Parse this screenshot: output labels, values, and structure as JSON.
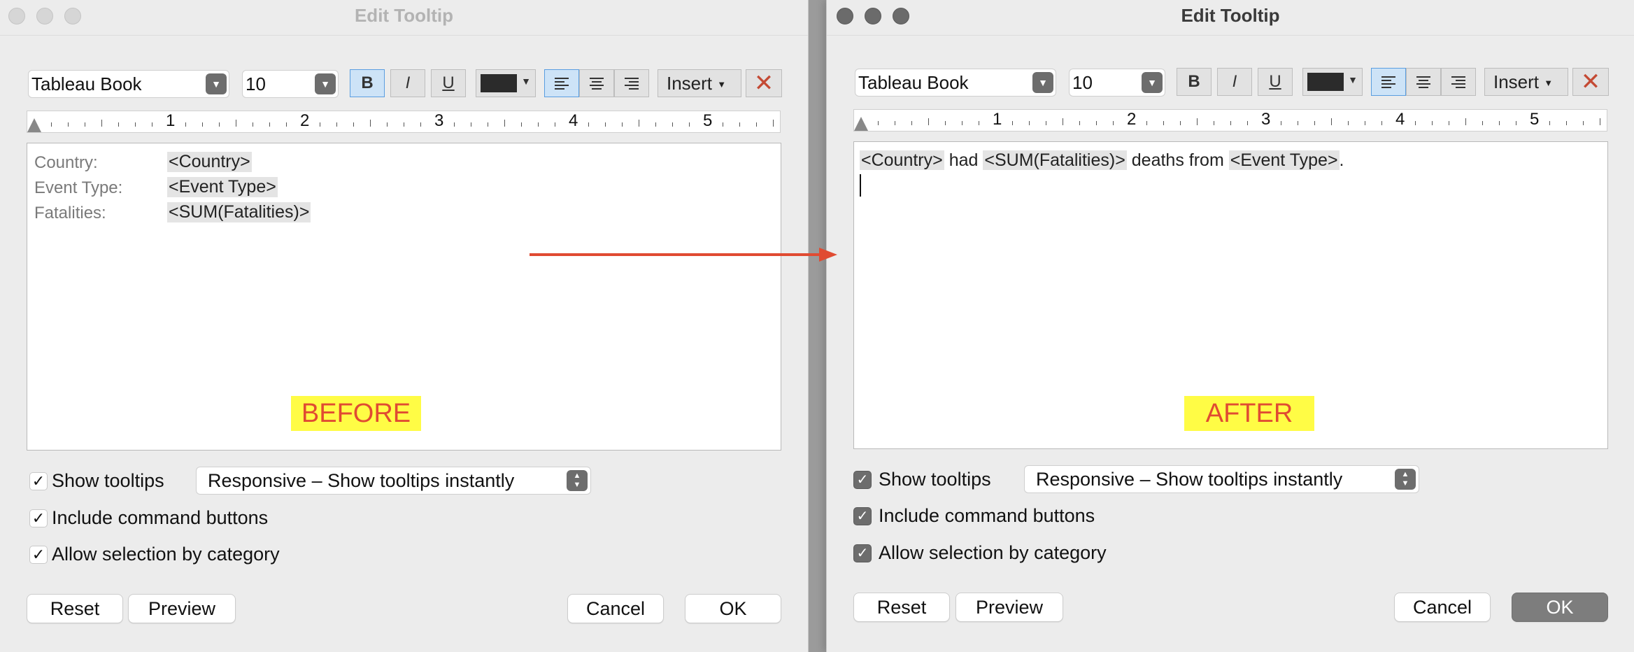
{
  "left_window": {
    "title": "Edit Tooltip",
    "toolbar": {
      "font": "Tableau Book",
      "size": "10",
      "bold": "B",
      "italic": "I",
      "underline": "U",
      "insert": "Insert",
      "text_color": "#2b2b2b"
    },
    "ruler_numbers": [
      "1",
      "2",
      "3",
      "4",
      "5"
    ],
    "editor_fields": [
      {
        "label": "Country:",
        "value": "<Country>"
      },
      {
        "label": "Event Type:",
        "value": "<Event Type>"
      },
      {
        "label": "Fatalities:",
        "value": "<SUM(Fatalities)>"
      }
    ],
    "caption": "BEFORE",
    "show_tooltips_label": "Show tooltips",
    "tooltip_mode": "Responsive – Show tooltips instantly",
    "include_buttons_label": "Include command buttons",
    "allow_selection_label": "Allow selection by category",
    "checkboxes_checked": [
      true,
      true,
      true
    ],
    "reset": "Reset",
    "preview": "Preview",
    "cancel": "Cancel",
    "ok": "OK"
  },
  "right_window": {
    "title": "Edit Tooltip",
    "toolbar": {
      "font": "Tableau Book",
      "size": "10",
      "bold": "B",
      "italic": "I",
      "underline": "U",
      "insert": "Insert",
      "text_color": "#2b2b2b"
    },
    "ruler_numbers": [
      "1",
      "2",
      "3",
      "4",
      "5"
    ],
    "sentence": {
      "field1": "<Country>",
      "text1": " had ",
      "field2": "<SUM(Fatalities)>",
      "text2": " deaths from ",
      "field3": "<Event Type>",
      "text3": "."
    },
    "caption": "AFTER",
    "show_tooltips_label": "Show tooltips",
    "tooltip_mode": "Responsive – Show tooltips instantly",
    "include_buttons_label": "Include command buttons",
    "allow_selection_label": "Allow selection by category",
    "checkboxes_checked": [
      true,
      true,
      true
    ],
    "reset": "Reset",
    "preview": "Preview",
    "cancel": "Cancel",
    "ok": "OK"
  },
  "colors": {
    "arrow": "#e04b32",
    "caption_bg": "#fffc45",
    "caption_text": "#e04b32",
    "highlight_blue": "#5a9ee0"
  },
  "icons": {
    "align_left": "align-left-icon",
    "align_center": "align-center-icon",
    "align_right": "align-right-icon",
    "clear": "clear-x-icon",
    "dropdown": "chevron-down-icon",
    "checkmark": "checkmark-icon"
  }
}
